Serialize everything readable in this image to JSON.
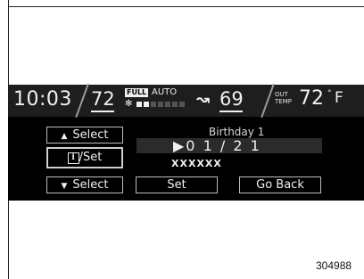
{
  "status_bar": {
    "time": "10:03",
    "driver_temp": "72",
    "fan_full": "FULL",
    "fan_mode": "AUTO",
    "fan_level": 0.33,
    "passenger_temp": "69",
    "outside_label_1": "OUT",
    "outside_label_2": "TEMP",
    "outside_temp": "72",
    "degree_symbol": "°",
    "unit": "F"
  },
  "controls": {
    "select_up": "Select",
    "info_set": "/Set",
    "select_down": "Select",
    "set": "Set",
    "go_back": "Go Back"
  },
  "field": {
    "title": "Birthday 1",
    "date": "▶0 1  /  2 1",
    "name": "XXXXXX"
  },
  "figure_number": "304988"
}
